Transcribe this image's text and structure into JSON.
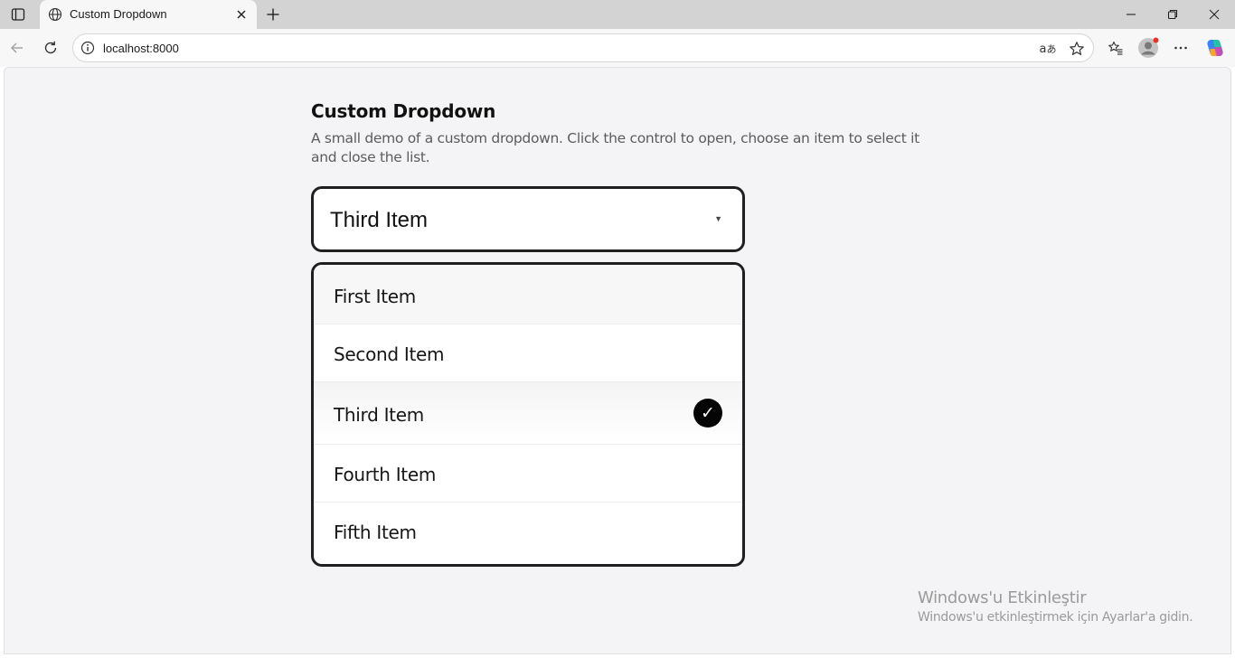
{
  "browser": {
    "tab_title": "Custom Dropdown",
    "url": "localhost:8000",
    "icons": {
      "sidebar": "sidebar-icon",
      "favicon": "globe-icon",
      "tab_close": "close-icon",
      "new_tab": "plus-icon",
      "back": "back-arrow-icon",
      "reload": "reload-icon",
      "site_info": "info-icon",
      "read_aloud": "read-aloud-icon",
      "favorite": "star-icon",
      "favorites": "favorites-icon",
      "profile": "avatar",
      "menu": "more-icon",
      "copilot": "copilot-icon"
    }
  },
  "page": {
    "title": "Custom Dropdown",
    "description": "A small demo of a custom dropdown. Click the control to open, choose an item to select it and close the list."
  },
  "dropdown": {
    "selected": "Third Item",
    "caret": "▼",
    "check_glyph": "✓",
    "open": true,
    "options": [
      {
        "label": "First Item",
        "selected": false,
        "hovered": true
      },
      {
        "label": "Second Item",
        "selected": false
      },
      {
        "label": "Third Item",
        "selected": true
      },
      {
        "label": "Fourth Item",
        "selected": false
      },
      {
        "label": "Fifth Item",
        "selected": false
      }
    ]
  },
  "watermark": {
    "title": "Windows'u Etkinleştir",
    "subtitle": "Windows'u etkinleştirmek için Ayarlar'a gidin."
  },
  "colors": {
    "page_bg": "#f4f4f6",
    "border": "#1f1f1f",
    "check_bg": "#050505",
    "text": "#111111",
    "muted": "#5c5c5c"
  }
}
